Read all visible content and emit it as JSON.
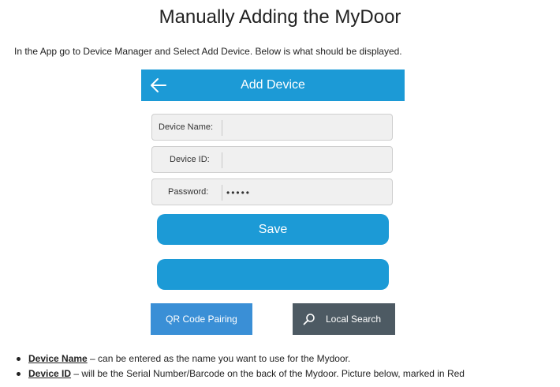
{
  "title": "Manually Adding the MyDoor",
  "intro": "In the App go to Device Manager and Select Add Device.  Below is what should be displayed.",
  "app": {
    "header_title": "Add Device",
    "fields": [
      {
        "label": "Device Name:",
        "value": ""
      },
      {
        "label": "Device ID:",
        "value": ""
      },
      {
        "label": "Password:",
        "value": "•••••"
      }
    ],
    "save_label": "Save",
    "qr_label": "QR Code Pairing",
    "search_label": "Local Search"
  },
  "bullets": [
    {
      "term": "Device Name",
      "text": " – can be entered as the name you want to use for the Mydoor."
    },
    {
      "term": "Device ID",
      "text": " – will be the Serial Number/Barcode on the back of the Mydoor. Picture below, marked in Red"
    }
  ],
  "colors": {
    "accent": "#1c9ad6",
    "qr_button": "#3a8fd6",
    "search_button": "#4d5a63"
  }
}
